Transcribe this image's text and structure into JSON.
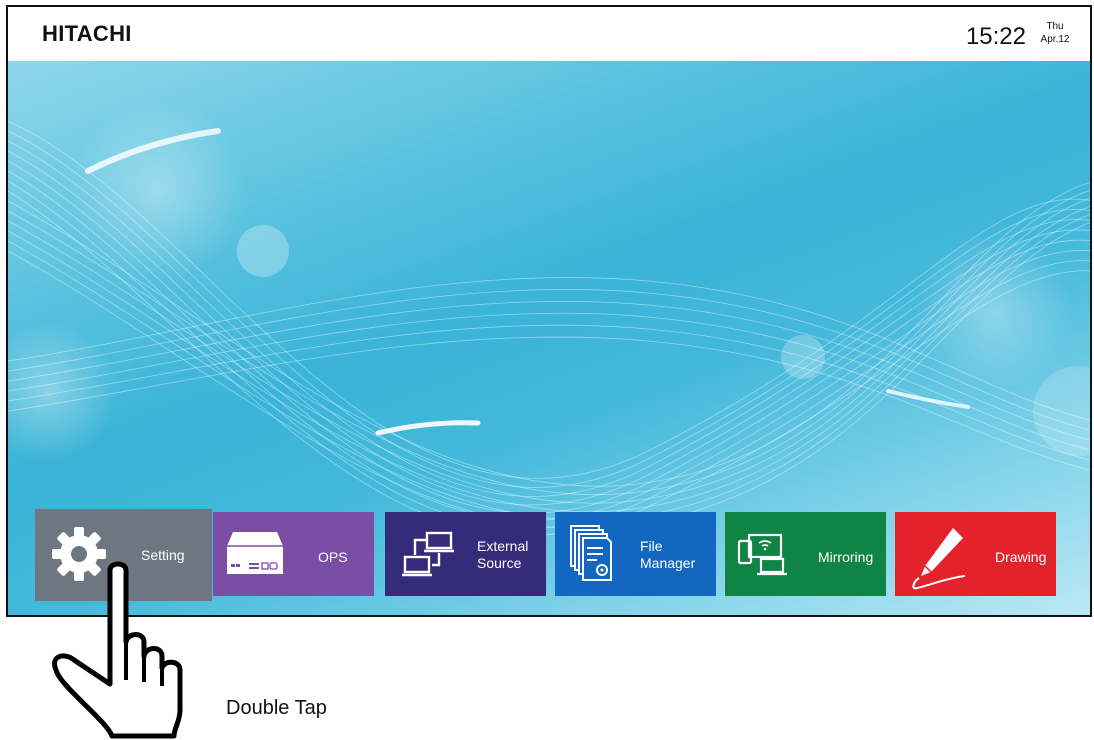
{
  "topbar": {
    "brand": "HITACHI",
    "time": "15:22",
    "day": "Thu",
    "date": "Apr.12"
  },
  "tiles": [
    {
      "label": "Setting",
      "icon": "gear-icon",
      "color": "#6e7781"
    },
    {
      "label": "OPS",
      "icon": "ops-device-icon",
      "color": "#7b4ea5"
    },
    {
      "label_line1": "External",
      "label_line2": "Source",
      "icon": "external-source-icon",
      "color": "#362a7a"
    },
    {
      "label_line1": "File",
      "label_line2": "Manager",
      "icon": "file-manager-icon",
      "color": "#1367c1"
    },
    {
      "label": "Mirroring",
      "icon": "mirroring-icon",
      "color": "#0f8445"
    },
    {
      "label": "Drawing",
      "icon": "pen-icon",
      "color": "#e3222c"
    }
  ],
  "gesture": {
    "icon": "hand-pointer-icon",
    "caption": "Double Tap"
  }
}
